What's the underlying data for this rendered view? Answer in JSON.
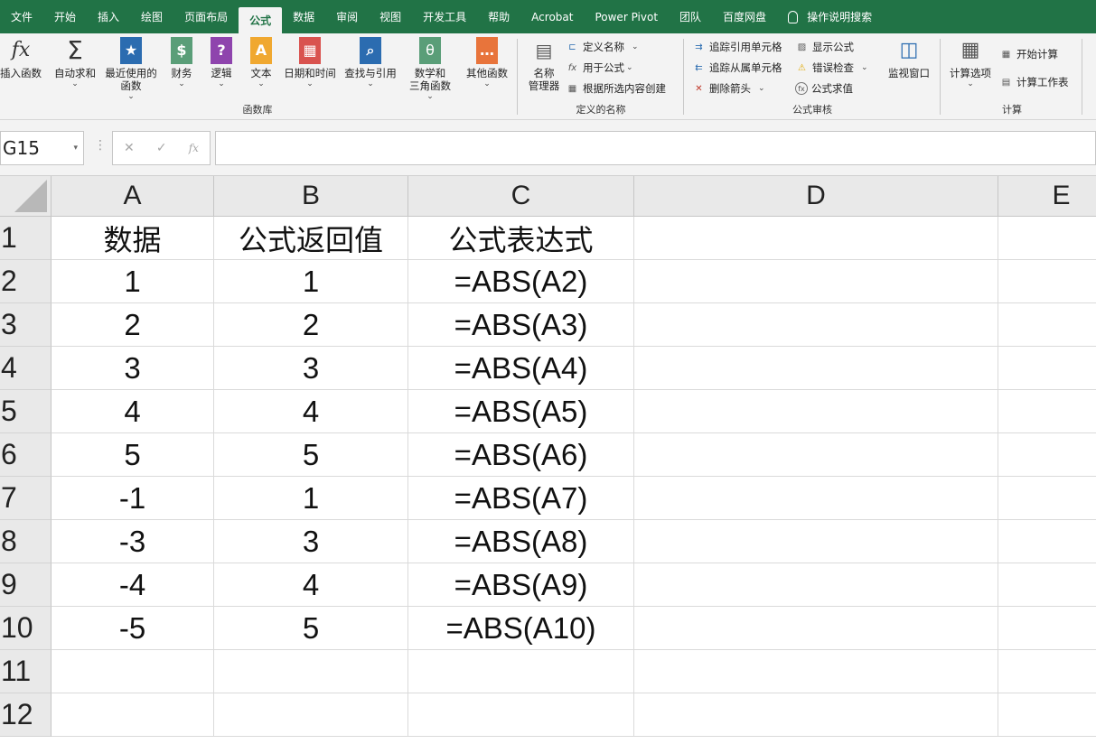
{
  "tabs": [
    "文件",
    "开始",
    "插入",
    "绘图",
    "页面布局",
    "公式",
    "数据",
    "审阅",
    "视图",
    "开发工具",
    "帮助",
    "Acrobat",
    "Power Pivot",
    "团队",
    "百度网盘"
  ],
  "active_tab": "公式",
  "tell_me": "操作说明搜索",
  "ribbon": {
    "function_library": {
      "label": "函数库",
      "insert_function": "插入函数",
      "autosum": "自动求和",
      "recent": "最近使用的\n函数",
      "financial": "财务",
      "logical": "逻辑",
      "text": "文本",
      "datetime": "日期和时间",
      "lookup": "查找与引用",
      "math": "数学和\n三角函数",
      "more": "其他函数"
    },
    "defined_names": {
      "label": "定义的名称",
      "name_manager": "名称\n管理器",
      "define_name": "定义名称",
      "use_in_formula": "用于公式",
      "create_from_selection": "根据所选内容创建"
    },
    "formula_auditing": {
      "label": "公式审核",
      "trace_precedents": "追踪引用单元格",
      "trace_dependents": "追踪从属单元格",
      "remove_arrows": "删除箭头",
      "show_formulas": "显示公式",
      "error_checking": "错误检查",
      "evaluate_formula": "公式求值",
      "watch_window": "监视窗口"
    },
    "calculation": {
      "label": "计算",
      "calc_options": "计算选项",
      "calc_now": "开始计算",
      "calc_sheet": "计算工作表"
    }
  },
  "formula_bar": {
    "name_box": "G15",
    "cancel_icon": "✕",
    "enter_icon": "✓",
    "fx_icon": "fx",
    "content": ""
  },
  "sheet": {
    "columns": [
      "A",
      "B",
      "C",
      "D",
      "E"
    ],
    "rows": [
      "1",
      "2",
      "3",
      "4",
      "5",
      "6",
      "7",
      "8",
      "9",
      "10",
      "11",
      "12"
    ],
    "cells": [
      [
        "数据",
        "公式返回值",
        "公式表达式",
        "",
        ""
      ],
      [
        "1",
        "1",
        "=ABS(A2)",
        "",
        ""
      ],
      [
        "2",
        "2",
        "=ABS(A3)",
        "",
        ""
      ],
      [
        "3",
        "3",
        "=ABS(A4)",
        "",
        ""
      ],
      [
        "4",
        "4",
        "=ABS(A5)",
        "",
        ""
      ],
      [
        "5",
        "5",
        "=ABS(A6)",
        "",
        ""
      ],
      [
        "-1",
        "1",
        "=ABS(A7)",
        "",
        ""
      ],
      [
        "-3",
        "3",
        "=ABS(A8)",
        "",
        ""
      ],
      [
        "-4",
        "4",
        "=ABS(A9)",
        "",
        ""
      ],
      [
        "-5",
        "5",
        "=ABS(A10)",
        "",
        ""
      ],
      [
        "",
        "",
        "",
        "",
        ""
      ],
      [
        "",
        "",
        "",
        "",
        ""
      ]
    ]
  },
  "colors": {
    "tab_bar": "#217346",
    "ribbon": "#f3f3f3",
    "header": "#e9e9e9"
  }
}
